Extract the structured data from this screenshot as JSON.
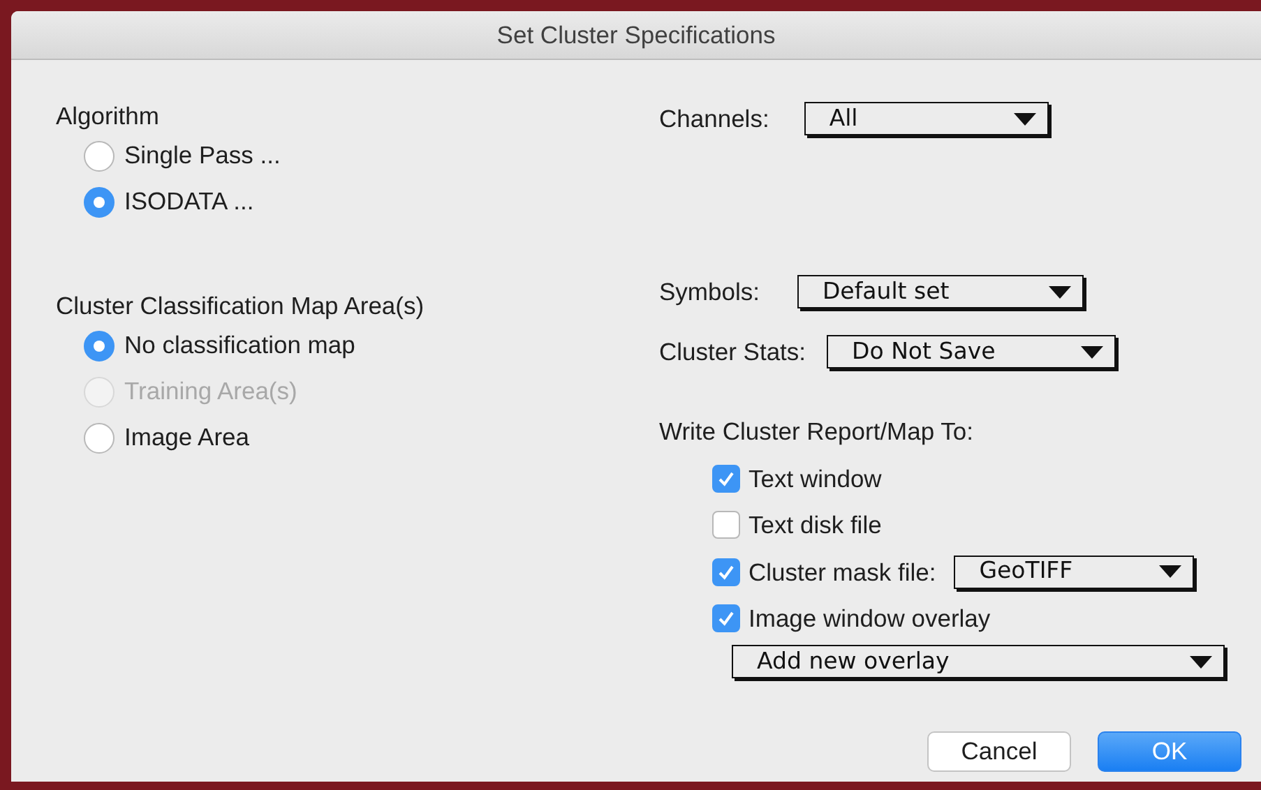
{
  "window": {
    "title": "Set Cluster Specifications"
  },
  "algorithm": {
    "label": "Algorithm",
    "options": [
      {
        "label": "Single Pass ...",
        "selected": false,
        "disabled": false
      },
      {
        "label": "ISODATA ...",
        "selected": true,
        "disabled": false
      }
    ]
  },
  "map_area": {
    "label": "Cluster Classification Map Area(s)",
    "options": [
      {
        "label": "No classification map",
        "selected": true,
        "disabled": false
      },
      {
        "label": "Training Area(s)",
        "selected": false,
        "disabled": true
      },
      {
        "label": "Image Area",
        "selected": false,
        "disabled": false
      }
    ]
  },
  "settings": [
    {
      "label": "Channels:",
      "value": "All"
    },
    {
      "label": "Symbols:",
      "value": "Default set"
    },
    {
      "label": "Cluster Stats:",
      "value": "Do Not Save"
    }
  ],
  "report": {
    "label": "Write Cluster Report/Map To:",
    "outputs": [
      {
        "kind": "plain",
        "label": "Text window",
        "checked": true
      },
      {
        "kind": "plain",
        "label": "Text disk file",
        "checked": false
      },
      {
        "kind": "inline",
        "label": "Cluster mask file:",
        "checked": true,
        "dropdown": "GeoTIFF"
      },
      {
        "kind": "stacked",
        "label": "Image window overlay",
        "checked": true,
        "dropdown": "Add new overlay"
      }
    ]
  },
  "buttons": [
    {
      "label": "Cancel",
      "kind": "secondary"
    },
    {
      "label": "OK",
      "kind": "primary"
    }
  ]
}
